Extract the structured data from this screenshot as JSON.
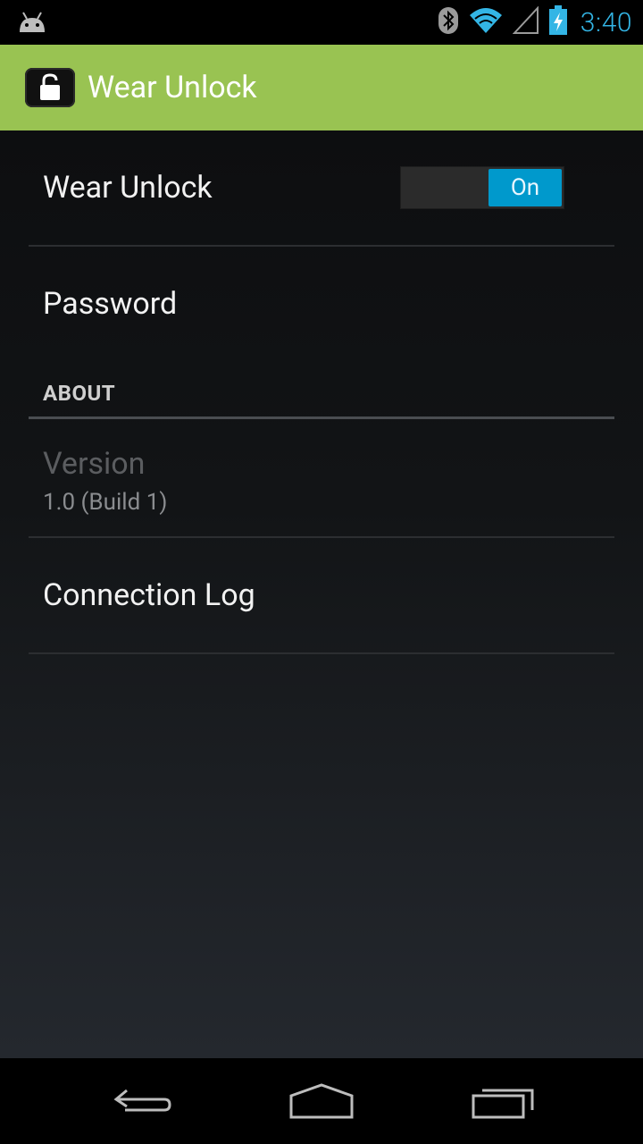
{
  "status_bar": {
    "time": "3:40",
    "icons": [
      "android-debug-icon",
      "bluetooth-icon",
      "wifi-icon",
      "signal-icon",
      "battery-charging-icon"
    ]
  },
  "action_bar": {
    "title": "Wear Unlock",
    "icon": "unlock-icon",
    "color": "#99c352"
  },
  "preferences": {
    "wear_unlock": {
      "title": "Wear Unlock",
      "switch_label": "On",
      "checked": true
    },
    "password": {
      "title": "Password"
    },
    "about_category": "ABOUT",
    "version": {
      "title": "Version",
      "summary": "1.0 (Build 1)"
    },
    "connection_log": {
      "title": "Connection Log"
    }
  },
  "nav_bar": {
    "buttons": [
      "back-icon",
      "home-icon",
      "recents-icon"
    ]
  },
  "colors": {
    "accent": "#33b5e5",
    "switch_on": "#0099cc"
  }
}
